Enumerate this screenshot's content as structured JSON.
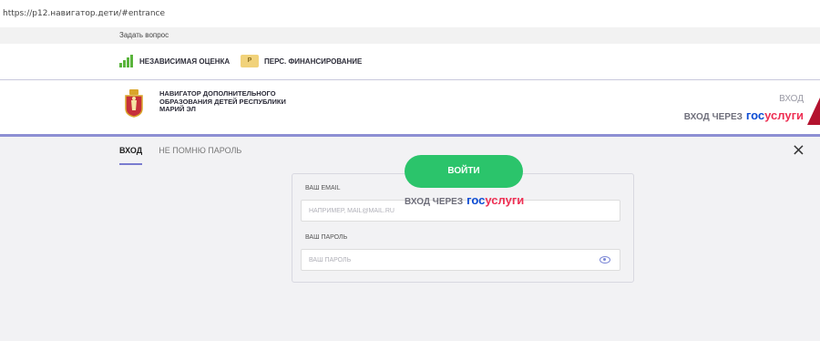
{
  "browser": {
    "url": "https://p12.навигатор.дети/#entrance"
  },
  "top_links": {
    "ask_question": "Задать вопрос",
    "independent_assessment": "НЕЗАВИСИМАЯ ОЦЕНКА",
    "personal_financing": "ПЕРС. ФИНАНСИРОВАНИЕ"
  },
  "header": {
    "title_line1": "НАВИГАТОР ДОПОЛНИТЕЛЬНОГО",
    "title_line2": "ОБРАЗОВАНИЯ ДЕТЕЙ РЕСПУБЛИКИ",
    "title_line3": "МАРИЙ ЭЛ",
    "login": "ВХОД",
    "login_via": "ВХОД ЧЕРЕЗ",
    "gos_part1": "гос",
    "gos_part2": "услуги"
  },
  "overlay": {
    "tab_login": "ВХОД",
    "tab_forgot": "НЕ ПОМНЮ ПАРОЛЬ",
    "close": "×",
    "email_label": "ВАШ EMAIL",
    "email_placeholder": "НАПРИМЕР, MAIL@MAIL.RU",
    "email_value": "",
    "password_label": "ВАШ ПАРОЛЬ",
    "password_placeholder": "ВАШ ПАРОЛЬ",
    "password_value": "",
    "submit": "ВОЙТИ",
    "login_via": "ВХОД ЧЕРЕЗ",
    "gos_part1": "гос",
    "gos_part2": "услуги"
  },
  "colors": {
    "accent_blue": "#8d8fd3",
    "button_green": "#2bc46b",
    "gos_blue": "#0d4cd3",
    "gos_red": "#ee2f53"
  }
}
